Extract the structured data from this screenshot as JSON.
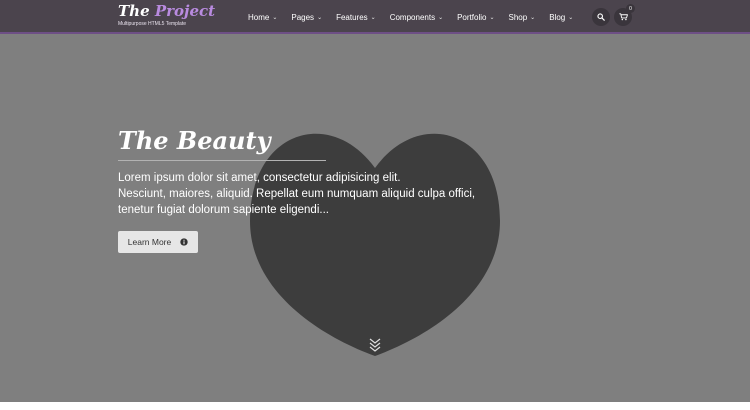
{
  "brand": {
    "title_main": "The ",
    "title_accent": "Project",
    "tagline": "Multipurpose HTML5 Template"
  },
  "nav": {
    "items": [
      {
        "label": "Home",
        "active": true
      },
      {
        "label": "Pages",
        "active": false
      },
      {
        "label": "Features",
        "active": false
      },
      {
        "label": "Components",
        "active": false
      },
      {
        "label": "Portfolio",
        "active": false
      },
      {
        "label": "Shop",
        "active": false
      },
      {
        "label": "Blog",
        "active": false
      }
    ],
    "cart_count": "0"
  },
  "hero": {
    "title": "The Beauty",
    "text_lines": [
      "Lorem ipsum dolor sit amet, consectetur adipisicing elit.",
      "Nesciunt, maiores, aliquid. Repellat eum numquam aliquid culpa offici,",
      "tenetur fugiat dolorum sapiente eligendi..."
    ],
    "button_label": "Learn More"
  },
  "colors": {
    "navbar": "#4b444d",
    "accent": "#b98be0",
    "hero_bg": "#7f7f7f",
    "heart": "#3d3d3d"
  }
}
